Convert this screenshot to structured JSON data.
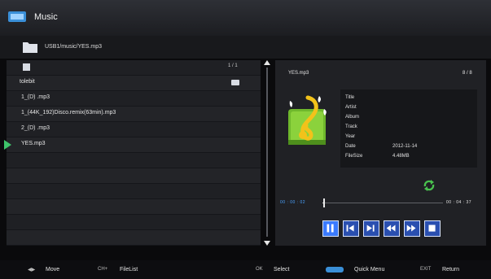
{
  "header": {
    "title": "Music",
    "logo_icon": "input-source-icon"
  },
  "path": {
    "icon": "folder-icon",
    "text": "USB1/music/YES.mp3"
  },
  "list": {
    "count": "1 / 1",
    "folder": "tolebit",
    "items": [
      {
        "label": "1_(D)        .mp3"
      },
      {
        "label": "1_(44K_192)Disco.remix(63min).mp3"
      },
      {
        "label": "2_(D)        .mp3"
      },
      {
        "label": "YES.mp3",
        "playing": true
      }
    ]
  },
  "info": {
    "filename": "YES.mp3",
    "index": "8 / 8",
    "fields": [
      {
        "label": "Title",
        "value": ""
      },
      {
        "label": "Artist",
        "value": ""
      },
      {
        "label": "Album",
        "value": ""
      },
      {
        "label": "Track",
        "value": ""
      },
      {
        "label": "Year",
        "value": ""
      },
      {
        "label": "Date",
        "value": "2012-11-14"
      },
      {
        "label": "FileSize",
        "value": "4.48MB"
      }
    ],
    "current_time": "00 : 00 : 02",
    "total_time": "00 : 04 : 37",
    "progress_fraction": 0.01
  },
  "controls": [
    {
      "name": "pause-button",
      "icon": "pause-icon",
      "active": true
    },
    {
      "name": "previous-button",
      "icon": "skip-previous-icon"
    },
    {
      "name": "next-button",
      "icon": "skip-next-icon"
    },
    {
      "name": "rewind-button",
      "icon": "rewind-icon"
    },
    {
      "name": "fast-forward-button",
      "icon": "fast-forward-icon"
    },
    {
      "name": "stop-button",
      "icon": "stop-icon"
    }
  ],
  "footer": {
    "move_key": "◀▶",
    "move_label": "Move",
    "ch_key": "CH+",
    "ch_label": "FileList",
    "ok_key": "OK",
    "ok_label": "Select",
    "quick_label": "Quick Menu",
    "exit_key": "EXIT",
    "exit_label": "Return"
  },
  "colors": {
    "accent": "#3a7aff",
    "playing": "#3ec46a",
    "progress_time": "#4aa3ff"
  }
}
